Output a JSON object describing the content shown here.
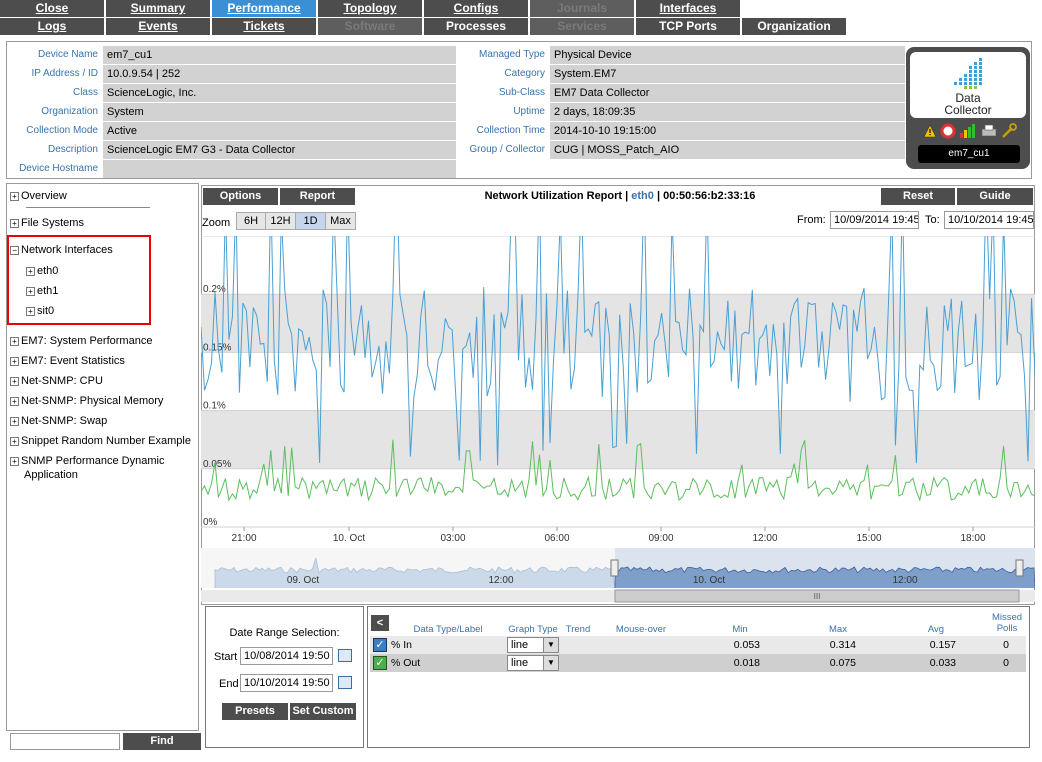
{
  "tabs": {
    "row1": [
      "Close",
      "Summary",
      "Performance",
      "Topology",
      "Configs",
      "Journals",
      "Interfaces"
    ],
    "row2": [
      "Logs",
      "Events",
      "Tickets",
      "Software",
      "Processes",
      "Services",
      "TCP Ports",
      "Organization"
    ]
  },
  "device": {
    "left": [
      {
        "label": "Device Name",
        "value": "em7_cu1"
      },
      {
        "label": "IP Address / ID",
        "value": "10.0.9.54 | 252"
      },
      {
        "label": "Class",
        "value": "ScienceLogic, Inc."
      },
      {
        "label": "Organization",
        "value": "System"
      },
      {
        "label": "Collection Mode",
        "value": "Active"
      },
      {
        "label": "Description",
        "value": "ScienceLogic EM7 G3 - Data Collector"
      },
      {
        "label": "Device Hostname",
        "value": ""
      }
    ],
    "right": [
      {
        "label": "Managed Type",
        "value": "Physical Device"
      },
      {
        "label": "Category",
        "value": "System.EM7"
      },
      {
        "label": "Sub-Class",
        "value": "EM7 Data Collector"
      },
      {
        "label": "Uptime",
        "value": "2 days, 18:09:35"
      },
      {
        "label": "Collection Time",
        "value": "2014-10-10 19:15:00"
      },
      {
        "label": "Group / Collector",
        "value": "CUG | MOSS_Patch_AIO"
      }
    ],
    "badge_title_1": "Data",
    "badge_title_2": "Collector",
    "badge_name": "em7_cu1"
  },
  "tree": {
    "overview": "Overview",
    "file_systems": "File Systems",
    "network_interfaces": "Network Interfaces",
    "eth0": "eth0",
    "eth1": "eth1",
    "sit0": "sit0",
    "sys_perf": "EM7: System Performance",
    "event_stats": "EM7: Event Statistics",
    "cpu": "Net-SNMP: CPU",
    "phys_mem": "Net-SNMP: Physical Memory",
    "swap": "Net-SNMP: Swap",
    "snippet": "Snippet Random Number Example",
    "snmp_dyn_1": "SNMP Performance Dynamic",
    "snmp_dyn_2": "Application",
    "find": "Find"
  },
  "report": {
    "options": "Options",
    "report": "Report",
    "title": "Network Utilization Report |",
    "iface": "eth0",
    "mac": "| 00:50:56:b2:33:16",
    "reset": "Reset",
    "guide": "Guide",
    "zoom_label": "Zoom",
    "zoom": [
      "6H",
      "12H",
      "1D",
      "Max"
    ],
    "from_label": "From:",
    "from_value": "10/09/2014 19:45",
    "to_label": "To:",
    "to_value": "10/10/2014 19:45",
    "nav_labels": [
      "09. Oct",
      "12:00",
      "10. Oct",
      "12:00"
    ],
    "scroll_glyph": "III"
  },
  "chart_data": {
    "type": "line",
    "x_ticks": [
      "21:00",
      "10. Oct",
      "03:00",
      "06:00",
      "09:00",
      "12:00",
      "15:00",
      "18:00"
    ],
    "y_ticks": [
      "0%",
      "0.05%",
      "0.1%",
      "0.15%",
      "0.2%"
    ],
    "ylim": [
      0,
      0.25
    ],
    "series": [
      {
        "name": "% In",
        "color": "#4a9fd4",
        "min": 0.053,
        "max": 0.314,
        "avg": 0.157
      },
      {
        "name": "% Out",
        "color": "#5cbf5c",
        "min": 0.018,
        "max": 0.075,
        "avg": 0.033
      }
    ]
  },
  "date_range": {
    "title": "Date Range Selection:",
    "start_label": "Start",
    "start_value": "10/08/2014 19:50",
    "end_label": "End",
    "end_value": "10/10/2014 19:50",
    "presets": "Presets",
    "set_custom": "Set Custom"
  },
  "table": {
    "collapse": "<",
    "headers": {
      "label": "Data Type/Label",
      "graph": "Graph Type",
      "trend": "Trend",
      "mouse": "Mouse-over",
      "min": "Min",
      "max": "Max",
      "avg": "Avg",
      "missed_1": "Missed",
      "missed_2": "Polls"
    },
    "rows": [
      {
        "label": "% In",
        "graph": "line",
        "min": "0.053",
        "max": "0.314",
        "avg": "0.157",
        "missed": "0"
      },
      {
        "label": "% Out",
        "graph": "line",
        "min": "0.018",
        "max": "0.075",
        "avg": "0.033",
        "missed": "0"
      }
    ]
  }
}
